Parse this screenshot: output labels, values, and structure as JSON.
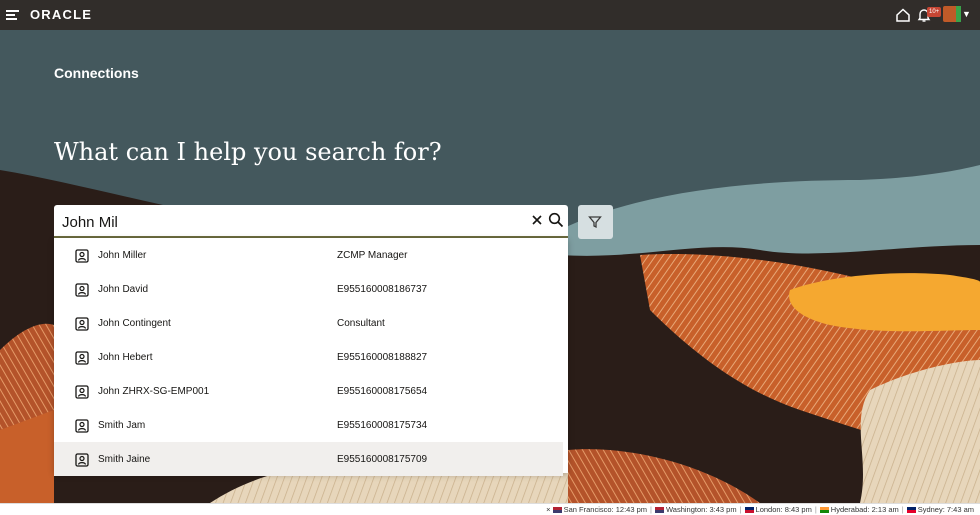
{
  "header": {
    "logo": "ORACLE",
    "notification_badge": "10+"
  },
  "main": {
    "page_title": "Connections",
    "prompt": "What can I help you search for?"
  },
  "search": {
    "value": "John Mil"
  },
  "results": [
    {
      "name": "John Miller",
      "detail": "ZCMP Manager"
    },
    {
      "name": "John David",
      "detail": "E955160008186737"
    },
    {
      "name": "John Contingent",
      "detail": "Consultant"
    },
    {
      "name": "John Hebert",
      "detail": "E955160008188827"
    },
    {
      "name": "John ZHRX-SG-EMP001",
      "detail": "E955160008175654"
    },
    {
      "name": "Smith Jam",
      "detail": "E955160008175734"
    },
    {
      "name": "Smith Jaine",
      "detail": "E955160008175709"
    }
  ],
  "world_clock": [
    {
      "label": "San Francisco: 12:43 pm",
      "flag": "us"
    },
    {
      "label": "Washington: 3:43 pm",
      "flag": "us"
    },
    {
      "label": "London: 8:43 pm",
      "flag": "uk"
    },
    {
      "label": "Hyderabad: 2:13 am",
      "flag": "in"
    },
    {
      "label": "Sydney: 7:43 am",
      "flag": "au"
    }
  ],
  "colors": {
    "topbar": "#312d2a",
    "hero_teal": "#44585d",
    "orange": "#c8602a",
    "yellow": "#f5a830"
  }
}
